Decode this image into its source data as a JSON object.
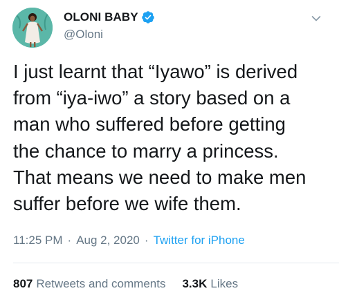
{
  "author": {
    "display_name": "OLONI BABY",
    "handle": "@Oloni",
    "verified": true
  },
  "tweet": {
    "text": "I just learnt that “Iyawo” is derived\nfrom “iya-iwo” a story based on a\nman who suffered before getting\nthe chance to marry a princess.\nThat means we need to make men\nsuffer before we wife them."
  },
  "meta": {
    "time": "11:25 PM",
    "date": "Aug 2, 2020",
    "separator": "·",
    "source": "Twitter for iPhone"
  },
  "stats": {
    "retweets_count": "807",
    "retweets_label": "Retweets and comments",
    "likes_count": "3.3K",
    "likes_label": "Likes"
  },
  "icons": {
    "verified": "verified-badge-icon",
    "menu": "chevron-down-icon"
  },
  "colors": {
    "text": "#14171a",
    "secondary": "#657786",
    "accent": "#1da1f2",
    "divider": "#e1e8ed",
    "avatar_bg": "#5bb7a8"
  }
}
